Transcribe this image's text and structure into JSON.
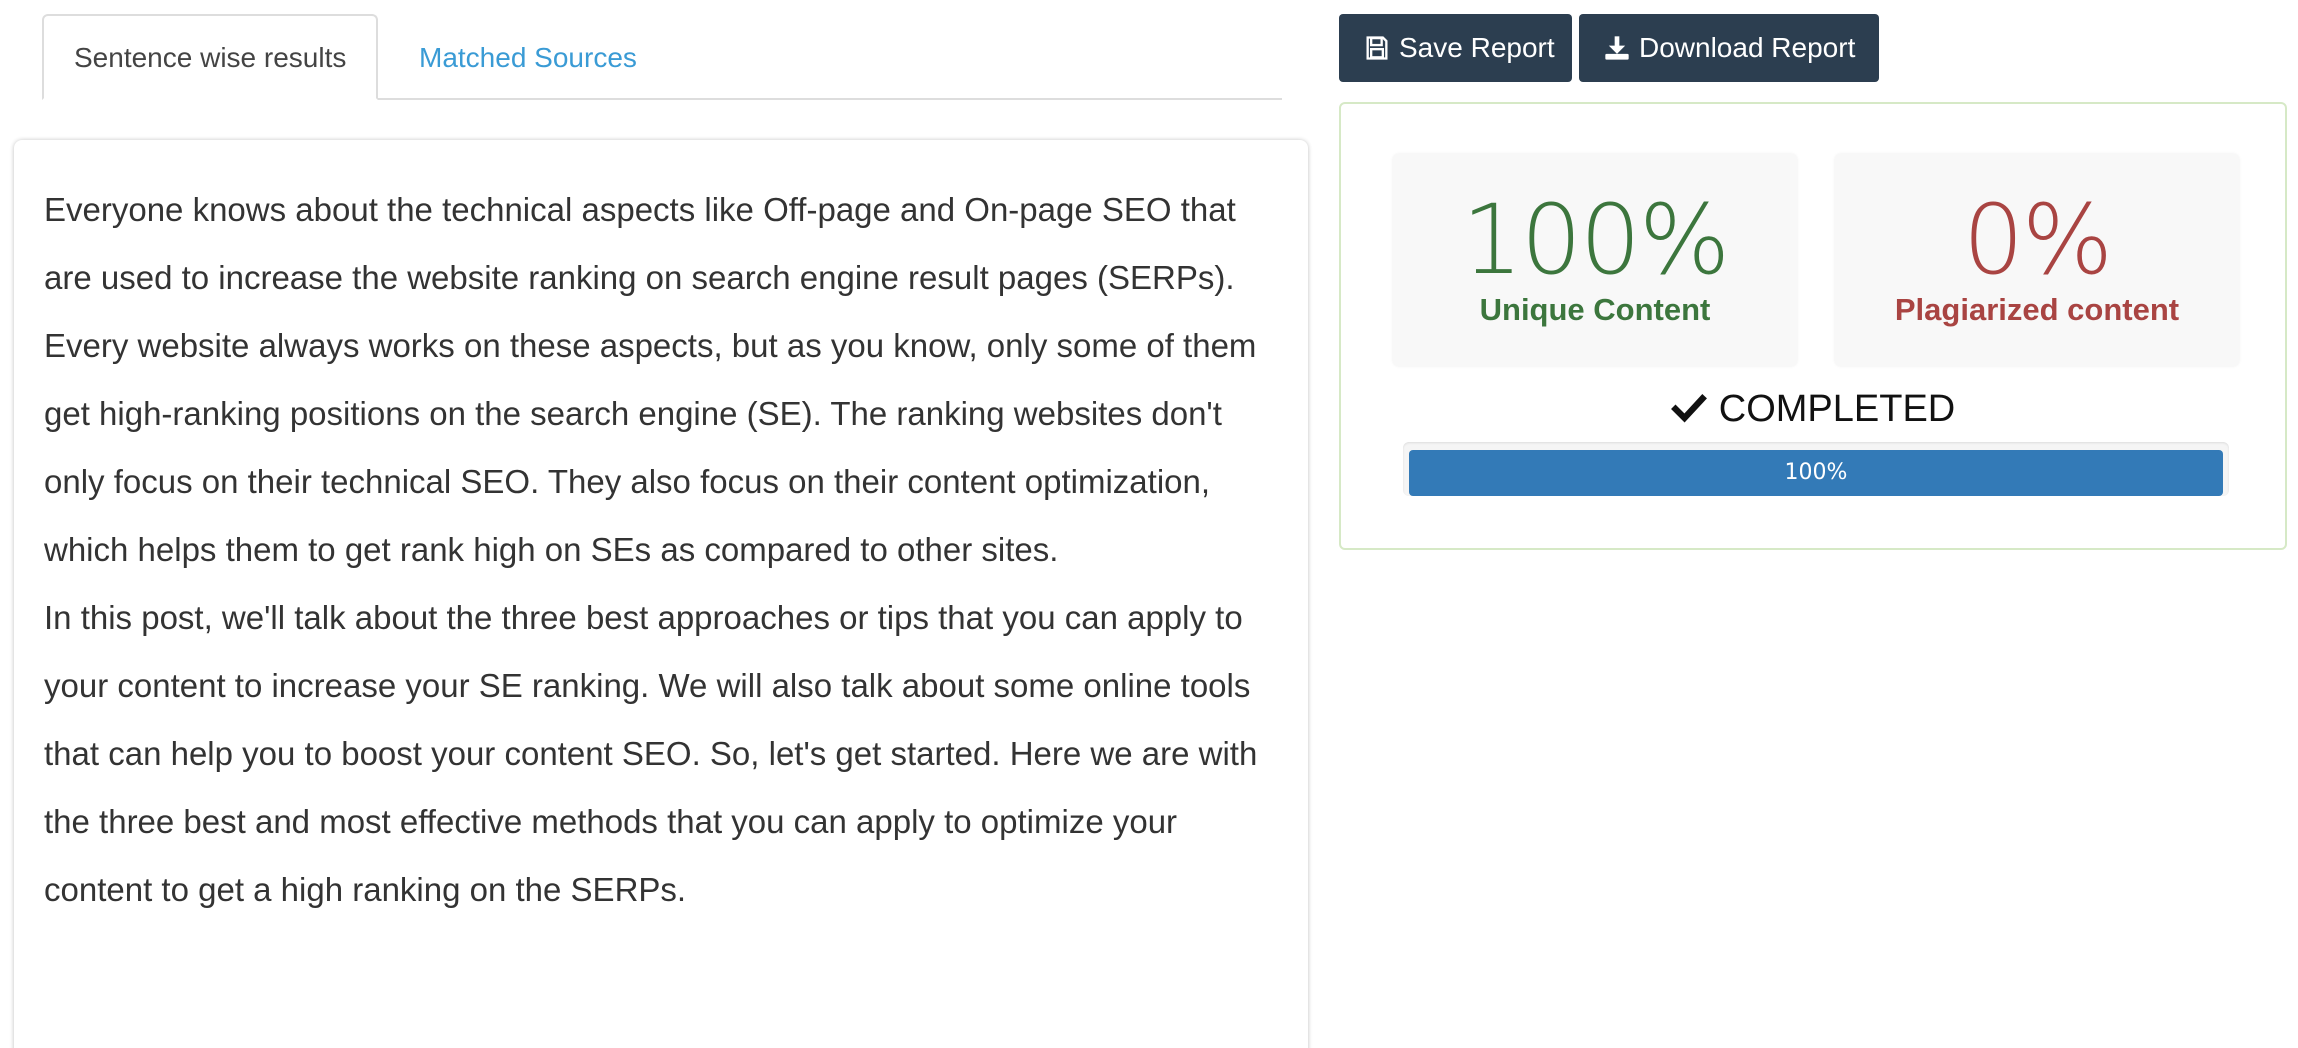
{
  "tabs": [
    {
      "label": "Sentence wise results",
      "active": true
    },
    {
      "label": "Matched Sources",
      "active": false
    }
  ],
  "content": {
    "paragraphs": [
      "Everyone knows about the technical aspects like Off-page and On-page SEO that are used to increase the website ranking on search engine result pages (SERPs). Every website always works on these aspects, but as you know, only some of them get high-ranking positions on the search engine (SE). The ranking websites don't only focus on their technical SEO. They also focus on their content optimization, which helps them to get rank high on SEs as compared to other sites.",
      "In this post, we'll talk about the three best approaches or tips that you can apply to your content to increase your SE ranking. We will also talk about some online tools that can help you to boost your content SEO. So, let's get started. Here we are with the three best and most effective methods that you can apply to optimize your content to get a high ranking on the SERPs."
    ]
  },
  "toolbar": {
    "save_label": "Save Report",
    "save_icon": "floppy-disk-icon",
    "download_label": "Download Report",
    "download_icon": "download-icon"
  },
  "results": {
    "unique": {
      "value": "100%",
      "label": "Unique Content",
      "color": "#3c763d"
    },
    "plagiarized": {
      "value": "0%",
      "label": "Plagiarized content",
      "color": "#a94442"
    },
    "status": {
      "icon": "check-icon",
      "text": "COMPLETED"
    },
    "progress": {
      "percent": 100,
      "label": "100%",
      "color": "#337ab7"
    }
  },
  "colors": {
    "button_bg": "#2c3e50",
    "tab_link": "#3a9bd5",
    "panel_border": "#d6e9c6"
  }
}
